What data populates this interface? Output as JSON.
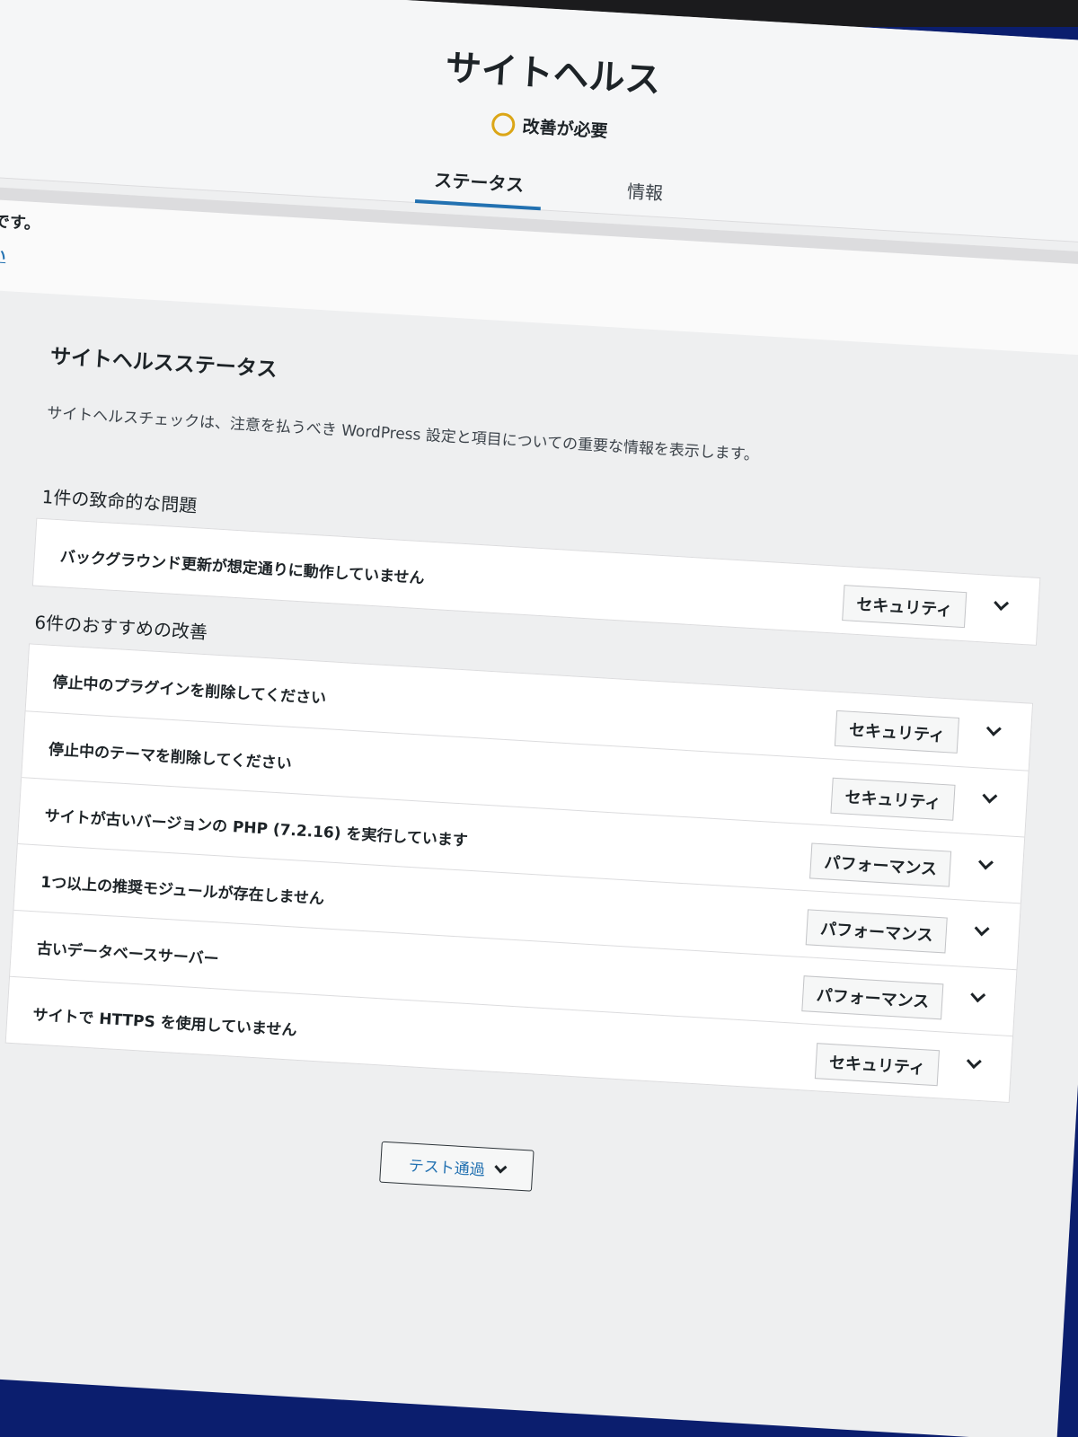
{
  "header": {
    "title": "サイトヘルス",
    "status": "改善が必要",
    "tabs": [
      {
        "label": "ステータス",
        "active": true
      },
      {
        "label": "情報",
        "active": false
      }
    ]
  },
  "notice": {
    "text": "能です。",
    "link": "ない"
  },
  "section": {
    "title": "サイトヘルスステータス",
    "description": "サイトヘルスチェックは、注意を払うべき WordPress 設定と項目についての重要な情報を表示します。"
  },
  "critical": {
    "heading": "1件の致命的な問題",
    "items": [
      {
        "title": "バックグラウンド更新が想定通りに動作していません",
        "badge": "セキュリティ"
      }
    ]
  },
  "recommended": {
    "heading": "6件のおすすめの改善",
    "items": [
      {
        "title": "停止中のプラグインを削除してください",
        "badge": "セキュリティ"
      },
      {
        "title": "停止中のテーマを削除してください",
        "badge": "セキュリティ"
      },
      {
        "title": "サイトが古いバージョンの PHP (7.2.16) を実行しています",
        "badge": "パフォーマンス"
      },
      {
        "title": "1つ以上の推奨モジュールが存在しません",
        "badge": "パフォーマンス"
      },
      {
        "title": "古いデータベースサーバー",
        "badge": "パフォーマンス"
      },
      {
        "title": "サイトで HTTPS を使用していません",
        "badge": "セキュリティ"
      }
    ]
  },
  "passed_tests": {
    "label": "テスト通過"
  },
  "colors": {
    "accent": "#2271b1",
    "status_warning": "#dba617",
    "bezel": "#1b1b1d",
    "desk": "#0b1e6e"
  }
}
